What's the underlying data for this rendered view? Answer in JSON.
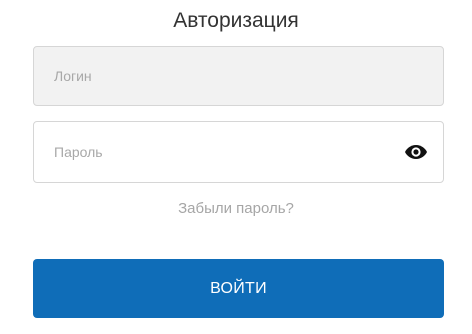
{
  "form": {
    "title": "Авторизация",
    "login": {
      "value": "",
      "placeholder": "Логин"
    },
    "password": {
      "value": "",
      "placeholder": "Пароль",
      "toggle_icon": "eye-icon"
    },
    "forgot_password_label": "Забыли пароль?",
    "submit_label": "ВОЙТИ"
  },
  "colors": {
    "primary_button": "#0f6db8",
    "login_field_background": "#f2f2f2",
    "placeholder_text": "#a8a8a8",
    "link_text": "#a6a6a6",
    "title_text": "#333333"
  }
}
